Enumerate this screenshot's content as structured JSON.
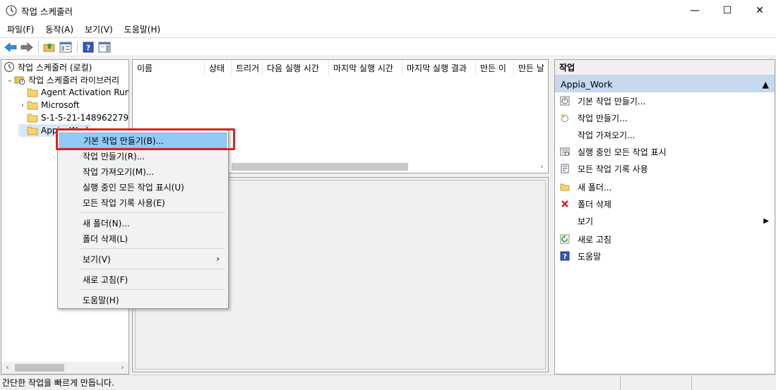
{
  "window": {
    "title": "작업 스케줄러",
    "minimize": "—",
    "maximize": "☐",
    "close": "✕"
  },
  "menubar": [
    "파일(F)",
    "동작(A)",
    "보기(V)",
    "도움말(H)"
  ],
  "tree": {
    "root": "작업 스케줄러 (로컬)",
    "library": "작업 스케줄러 라이브러리",
    "items": [
      {
        "label": "Agent Activation Run",
        "expandable": false
      },
      {
        "label": "Microsoft",
        "expandable": true
      },
      {
        "label": "S-1-5-21-148962279",
        "expandable": false
      },
      {
        "label": "Appia_Work",
        "expandable": false
      }
    ]
  },
  "columns": [
    "이름",
    "상태",
    "트리거",
    "다음 실행 시간",
    "마지막 실행 시간",
    "마지막 실행 결과",
    "만든 이",
    "만든 날"
  ],
  "actions_pane": {
    "header": "작업",
    "section": "Appia_Work",
    "items": [
      {
        "label": "기본 작업 만들기...",
        "icon": "create-basic-task-icon"
      },
      {
        "label": "작업 만들기...",
        "icon": "create-task-icon"
      },
      {
        "label": "작업 가져오기...",
        "icon": ""
      },
      {
        "label": "실행 중인 모든 작업 표시",
        "icon": "running-tasks-icon"
      },
      {
        "label": "모든 작업 기록 사용",
        "icon": "history-icon"
      },
      {
        "label": "새 폴더...",
        "icon": "new-folder-icon"
      },
      {
        "label": "폴더 삭제",
        "icon": "delete-icon"
      },
      {
        "label": "보기",
        "icon": "",
        "submenu": true
      },
      {
        "label": "새로 고침",
        "icon": "refresh-icon"
      },
      {
        "label": "도움말",
        "icon": "help-icon"
      }
    ]
  },
  "context_menu": {
    "items": [
      {
        "label": "기본 작업 만들기(B)...",
        "highlighted": true
      },
      {
        "label": "작업 만들기(R)..."
      },
      {
        "label": "작업 가져오기(M)..."
      },
      {
        "label": "실행 중인 모든 작업 표시(U)"
      },
      {
        "label": "모든 작업 기록 사용(E)"
      },
      {
        "label": "새 폴더(N)..."
      },
      {
        "label": "폴더 삭제(L)"
      },
      {
        "label": "보기(V)",
        "submenu": true
      },
      {
        "label": "새로 고침(F)"
      },
      {
        "label": "도움말(H)"
      }
    ]
  },
  "statusbar": {
    "text": "간단한 작업을 빠르게 만듭니다."
  },
  "colors": {
    "highlight": "#91c9f7",
    "section_bg": "#c5d9ef",
    "annotation_red": "#e02020"
  }
}
